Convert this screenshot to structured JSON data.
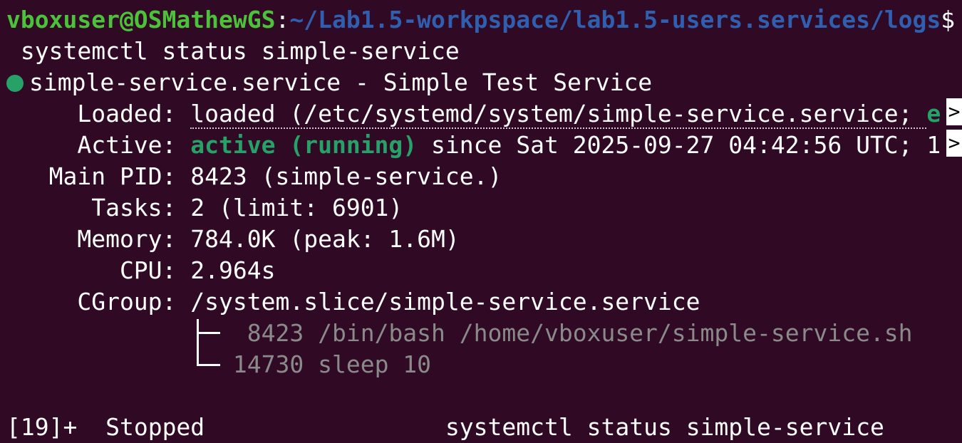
{
  "prompt": {
    "user_host": "vboxuser@OSMathewGS",
    "colon": ":",
    "path": "~/Lab1.5-workpspace/lab1.5-users.services/logs",
    "symbol": "$"
  },
  "command": " systemctl status simple-service",
  "status": {
    "indicator_color": "#26a269",
    "unit_line": "simple-service.service - Simple Test Service",
    "loaded_label": "     Loaded: ",
    "loaded_value": "loaded (/etc/systemd/system/simple-service.service; ",
    "loaded_tail": "e",
    "active_label": "     Active: ",
    "active_state": "active (running)",
    "active_since": " since Sat 2025-09-27 04:42:56 UTC; 1",
    "main_pid_label": "   Main PID: ",
    "main_pid_value": "8423 (simple-service.)",
    "tasks_label": "      Tasks: ",
    "tasks_value": "2 (limit: 6901)",
    "memory_label": "     Memory: ",
    "memory_value": "784.0K (peak: 1.6M)",
    "cpu_label": "        CPU: ",
    "cpu_value": "2.964s",
    "cgroup_label": "     CGroup: ",
    "cgroup_value": "/system.slice/simple-service.service",
    "processes": [
      " 8423 /bin/bash /home/vboxuser/simple-service.sh",
      "14730 sleep 10"
    ],
    "truncation_marker": ">"
  },
  "job": {
    "id": "[19]+",
    "state": "Stopped",
    "command": "systemctl status simple-service"
  }
}
